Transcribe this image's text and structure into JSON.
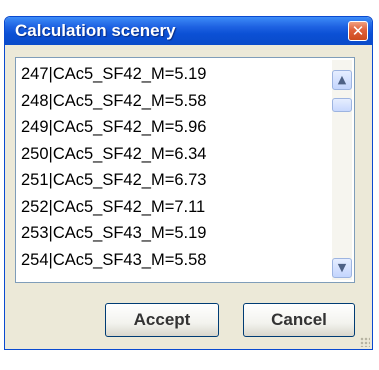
{
  "window": {
    "title": "Calculation scenery",
    "close_label": "✕"
  },
  "list": {
    "items": [
      "247|CAc5_SF42_M=5.19",
      "248|CAc5_SF42_M=5.58",
      "249|CAc5_SF42_M=5.96",
      "250|CAc5_SF42_M=6.34",
      "251|CAc5_SF42_M=6.73",
      "252|CAc5_SF42_M=7.11",
      "253|CAc5_SF43_M=5.19",
      "254|CAc5_SF43_M=5.58"
    ],
    "scroll_up_icon": "▲",
    "scroll_down_icon": "▼"
  },
  "buttons": {
    "accept_label": "Accept",
    "cancel_label": "Cancel"
  },
  "colors": {
    "titlebar": "#0b50d5",
    "dialog_bg": "#ece9d8",
    "close_button": "#e0603a"
  }
}
